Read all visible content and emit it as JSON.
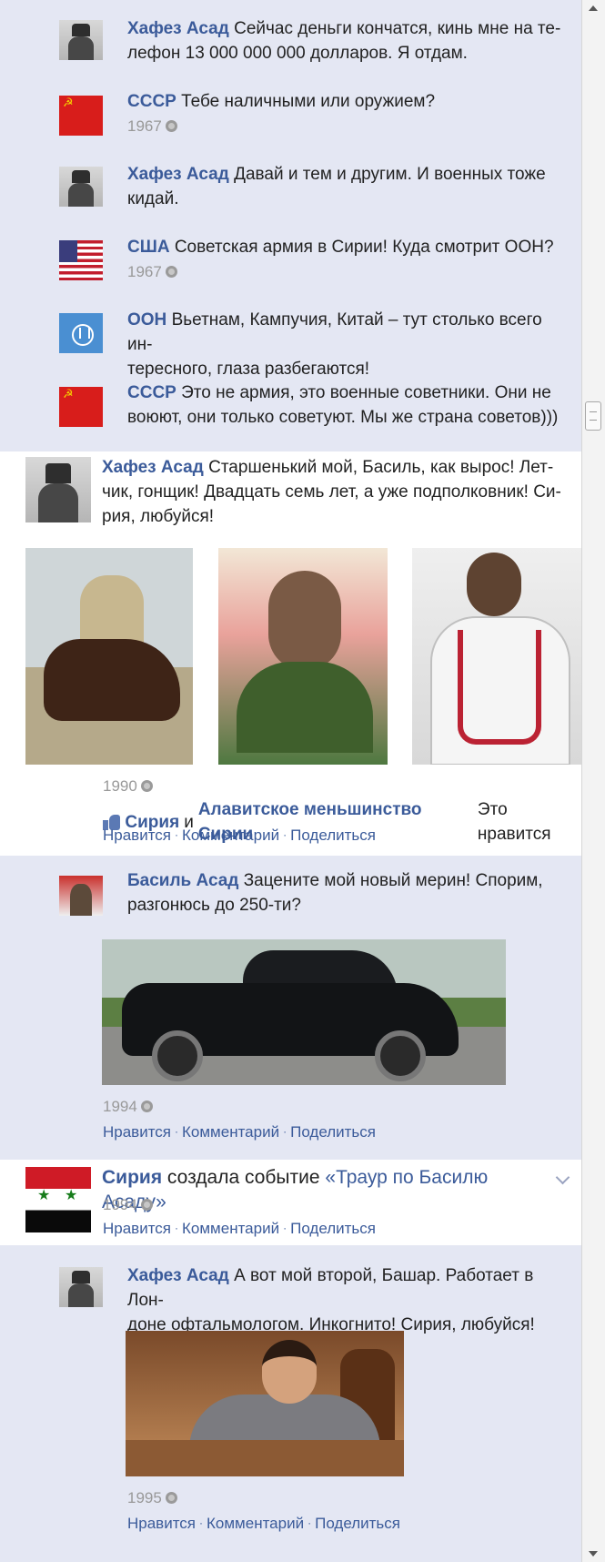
{
  "posts": [
    {
      "name": "Хафез Асад",
      "lines": [
        "Сейчас деньги кончатся, кинь мне на те-",
        "лефон 13 000 000 000 долларов. Я отдам."
      ],
      "meta": ""
    },
    {
      "name": "СССР",
      "lines": [
        "Тебе наличными или оружием?"
      ],
      "meta": "1967"
    },
    {
      "name": "Хафез Асад",
      "lines": [
        "Давай и тем и другим. И военных тоже",
        "кидай."
      ],
      "meta": ""
    },
    {
      "name": "США",
      "lines": [
        "Советская армия в Сирии! Куда смотрит ООН?"
      ],
      "meta": "1967"
    },
    {
      "name": "ООН",
      "lines": [
        "Вьетнам, Кампучия, Китай – тут столько всего ин-",
        "тересного, глаза разбегаются!"
      ],
      "meta": ""
    },
    {
      "name": "СССР",
      "lines": [
        "Это не армия, это военные советники. Они не",
        "воюют, они только советуют. Мы же страна советов)))"
      ],
      "meta": ""
    }
  ],
  "basil_post": {
    "name": "Хафез Асад",
    "lines": [
      "Старшенький мой, Басиль, как вырос! Лет-",
      "чик, гонщик! Двадцать семь лет, а уже подполковник! Си-",
      "рия, любуйся!"
    ],
    "meta": "1990",
    "likes": {
      "a": "Сирия",
      "and": "и",
      "b": "Алавитское меньшинство Сирии",
      "suffix": "Это нравится"
    },
    "actions": [
      "Нравится",
      "Комментарий",
      "Поделиться"
    ]
  },
  "car_post": {
    "name": "Басиль Асад",
    "lines": [
      "Зацените мой новый мерин! Спорим,",
      "разгонюсь до 250-ти?"
    ],
    "meta": "1994",
    "actions": [
      "Нравится",
      "Комментарий",
      "Поделиться"
    ]
  },
  "event_post": {
    "name": "Сирия",
    "text": "создала событие",
    "event": "«Траур по Басилю Асаду»",
    "meta": "1994",
    "actions": [
      "Нравится",
      "Комментарий",
      "Поделиться"
    ]
  },
  "bashar_post": {
    "name": "Хафез Асад",
    "lines": [
      "А вот мой второй, Башар. Работает в Лон-",
      "доне офтальмологом. Инкогнито! Сирия, любуйся!"
    ],
    "meta": "1995",
    "actions": [
      "Нравится",
      "Комментарий",
      "Поделиться"
    ]
  },
  "icons": {
    "globe": "globe-icon",
    "like": "thumbs-up-icon",
    "chevron": "chevron-down-icon"
  },
  "colors": {
    "link": "#3b5b9a",
    "feed_bg": "#e4e7f3",
    "card_bg": "#ffffff",
    "meta": "#999999"
  }
}
